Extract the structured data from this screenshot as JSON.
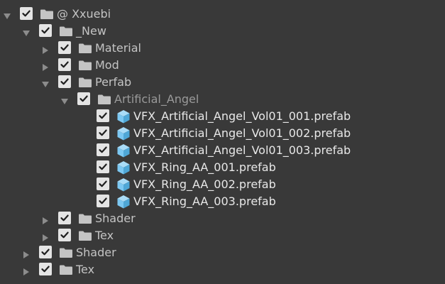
{
  "tree": [
    {
      "label": "@ Xxuebi",
      "depth": 0,
      "expanded": true,
      "type": "folder",
      "checked": true
    },
    {
      "label": "_New",
      "depth": 1,
      "expanded": true,
      "type": "folder",
      "checked": true
    },
    {
      "label": "Material",
      "depth": 2,
      "expanded": false,
      "type": "folder",
      "checked": true
    },
    {
      "label": "Mod",
      "depth": 2,
      "expanded": false,
      "type": "folder",
      "checked": true
    },
    {
      "label": "Perfab",
      "depth": 2,
      "expanded": true,
      "type": "folder",
      "checked": true
    },
    {
      "label": "Artificial_Angel",
      "depth": 3,
      "expanded": true,
      "type": "folder",
      "checked": true,
      "dim": true
    },
    {
      "label": "VFX_Artificial_Angel_Vol01_001.prefab",
      "depth": 4,
      "type": "prefab",
      "checked": true
    },
    {
      "label": "VFX_Artificial_Angel_Vol01_002.prefab",
      "depth": 4,
      "type": "prefab",
      "checked": true
    },
    {
      "label": "VFX_Artificial_Angel_Vol01_003.prefab",
      "depth": 4,
      "type": "prefab",
      "checked": true
    },
    {
      "label": "VFX_Ring_AA_001.prefab",
      "depth": 4,
      "type": "prefab",
      "checked": true
    },
    {
      "label": "VFX_Ring_AA_002.prefab",
      "depth": 4,
      "type": "prefab",
      "checked": true
    },
    {
      "label": "VFX_Ring_AA_003.prefab",
      "depth": 4,
      "type": "prefab",
      "checked": true
    },
    {
      "label": "Shader",
      "depth": 2,
      "expanded": false,
      "type": "folder",
      "checked": true
    },
    {
      "label": "Tex",
      "depth": 2,
      "expanded": false,
      "type": "folder",
      "checked": true
    },
    {
      "label": "Shader",
      "depth": 1,
      "expanded": false,
      "type": "folder",
      "checked": true
    },
    {
      "label": "Tex",
      "depth": 1,
      "expanded": false,
      "type": "folder",
      "checked": true
    }
  ],
  "colors": {
    "background": "#393939",
    "folder_icon": "#c4c4c4",
    "prefab_icon": "#7cc8f2",
    "checkbox": "#e4e4e4",
    "foldout_arrow": "#8c8c8c"
  },
  "icons": {
    "folder": "folder-icon",
    "prefab": "prefab-cube-icon",
    "expanded": "foldout-expanded-icon",
    "collapsed": "foldout-collapsed-icon",
    "checkmark": "checkmark-icon"
  }
}
